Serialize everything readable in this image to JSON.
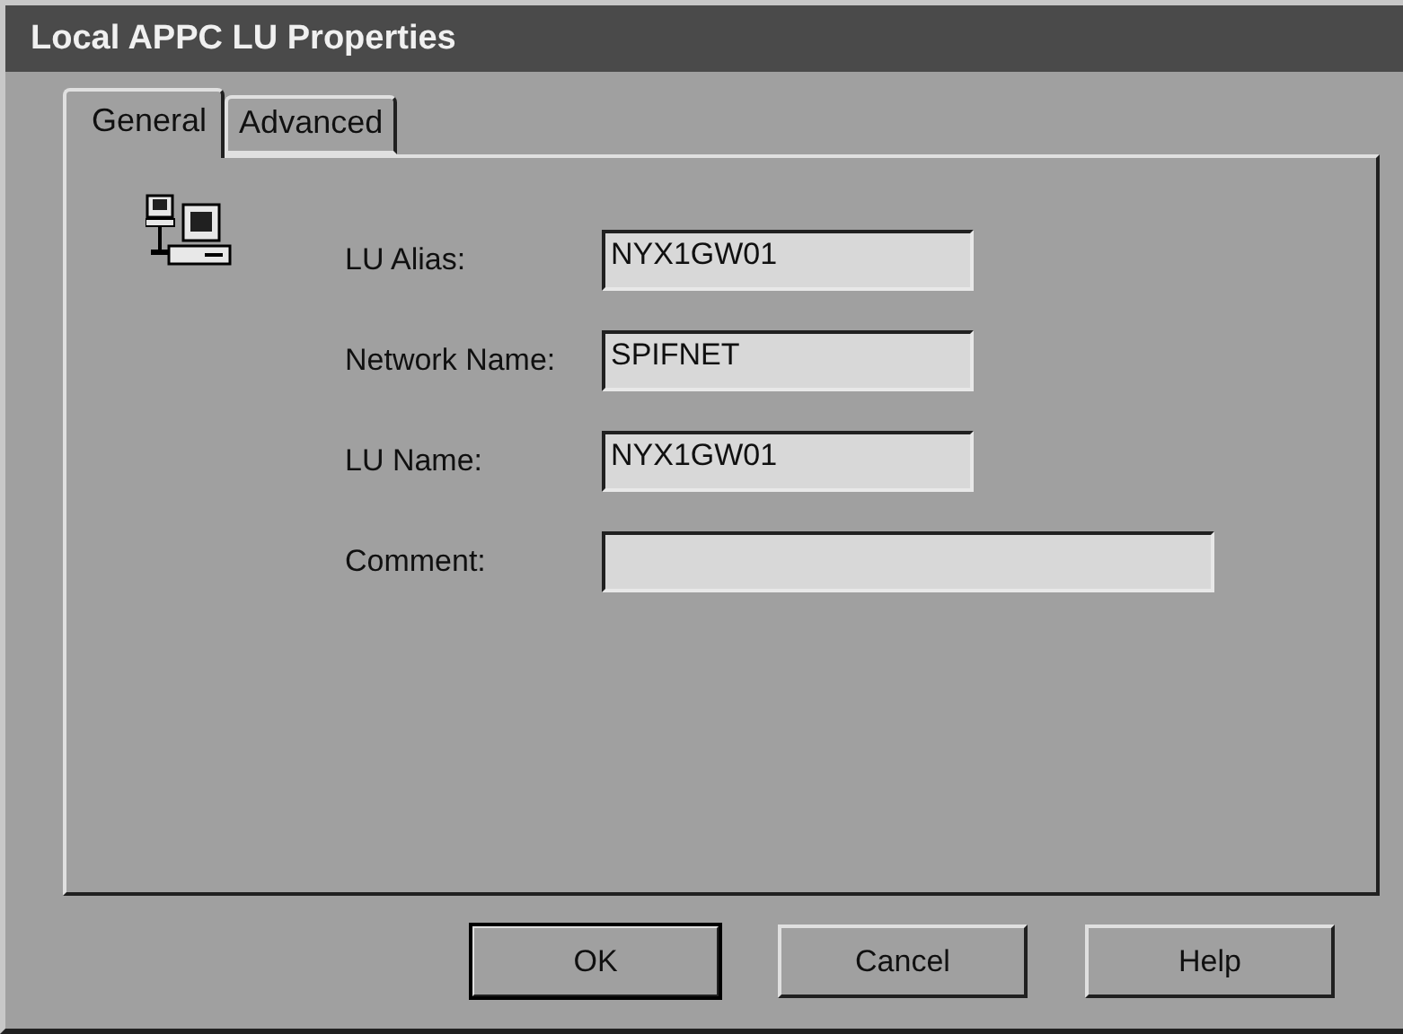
{
  "window": {
    "title": "Local APPC LU Properties"
  },
  "tabs": [
    {
      "label": "General",
      "selected": true
    },
    {
      "label": "Advanced",
      "selected": false
    }
  ],
  "fields": [
    {
      "label": "LU Alias:",
      "value": "NYX1GW01",
      "wide": false
    },
    {
      "label": "Network Name:",
      "value": "SPIFNET",
      "wide": false
    },
    {
      "label": "LU Name:",
      "value": "NYX1GW01",
      "wide": false
    },
    {
      "label": "Comment:",
      "wide": true
    }
  ],
  "buttons": [
    {
      "label": "OK",
      "default": true
    },
    {
      "label": "Cancel",
      "default": false
    },
    {
      "label": "Help",
      "default": false
    }
  ]
}
